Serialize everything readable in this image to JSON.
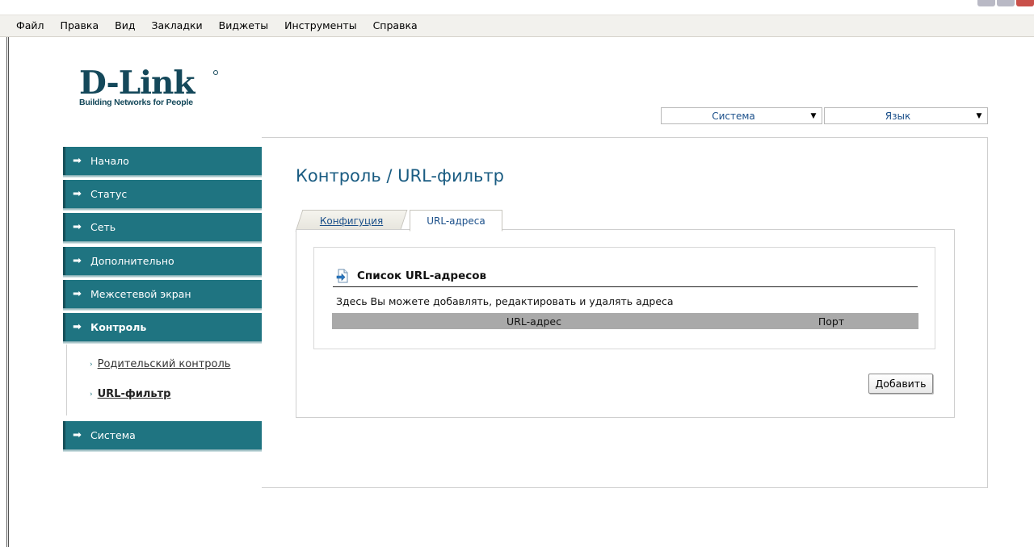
{
  "menubar": {
    "items": [
      "Файл",
      "Правка",
      "Вид",
      "Закладки",
      "Виджеты",
      "Инструменты",
      "Справка"
    ]
  },
  "logo": {
    "brand": "D-Link",
    "tagline": "Building Networks for People"
  },
  "header": {
    "system_select": "Система",
    "language_select": "Язык"
  },
  "sidebar": {
    "items": [
      {
        "label": "Начало",
        "active": false
      },
      {
        "label": "Статус",
        "active": false
      },
      {
        "label": "Сеть",
        "active": false
      },
      {
        "label": "Дополнительно",
        "active": false
      },
      {
        "label": "Межсетевой экран",
        "active": false
      },
      {
        "label": "Контроль",
        "active": true
      },
      {
        "label": "Система",
        "active": false
      }
    ],
    "subitems": [
      {
        "label": "Родительский контроль",
        "active": false
      },
      {
        "label": "URL-фильтр",
        "active": true
      }
    ]
  },
  "main": {
    "title": "Контроль / URL-фильтр",
    "tabs": [
      {
        "label": "Конфигуция",
        "active": false
      },
      {
        "label": "URL-адреса",
        "active": true
      }
    ],
    "section": {
      "title": "Список URL-адресов",
      "description": "Здесь Вы можете добавлять, редактировать и удалять адреса",
      "columns": [
        "URL-адрес",
        "Порт"
      ],
      "rows": []
    },
    "add_button": "Добавить"
  },
  "colors": {
    "nav_bg": "#1f7481",
    "brand": "#14485a",
    "title": "#1a5c82",
    "link": "#1a4f8a",
    "table_header": "#a9a9a9"
  },
  "icons": {
    "nav_arrow": "arrow-right-icon",
    "section": "document-arrow-icon",
    "dropdown": "chevron-down-icon"
  }
}
